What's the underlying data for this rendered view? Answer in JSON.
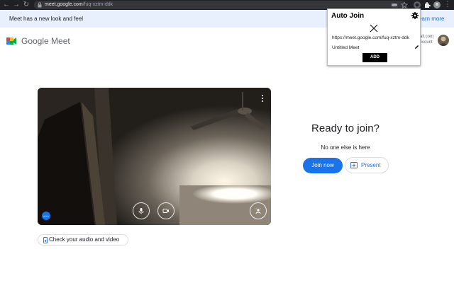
{
  "browser": {
    "url_host": "meet.google.com",
    "url_path": "/fuq-xztm-ddk"
  },
  "banner": {
    "text": "Meet has a new look and feel",
    "link": "earn more"
  },
  "header": {
    "logo_text": "Google Meet",
    "account_email_fragment": "ail.com",
    "account_label_fragment": "ccount"
  },
  "preview": {
    "check_av_label": "Check your audio and video"
  },
  "join_panel": {
    "title": "Ready to join?",
    "status": "No one else is here",
    "join_label": "Join now",
    "present_label": "Present"
  },
  "popup": {
    "title": "Auto Join",
    "meeting_url": "https://meet.google.com/fuq-xztm-ddk",
    "meeting_name": "Untitled Meet",
    "add_label": "ADD"
  },
  "colors": {
    "accent": "#1a73e8",
    "chrome_bar": "#202124",
    "banner_bg": "#e8f0fe",
    "text": "#202124"
  },
  "icons": [
    "back-icon",
    "forward-icon",
    "reload-icon",
    "lock-icon",
    "extension-icon",
    "puzzle-icon",
    "profile-icon",
    "meet-logo-icon",
    "microphone-icon",
    "camera-icon",
    "effects-icon",
    "more-vert-icon",
    "more-horiz-icon",
    "audio-check-icon",
    "present-icon",
    "gear-icon",
    "close-icon",
    "pencil-icon"
  ]
}
